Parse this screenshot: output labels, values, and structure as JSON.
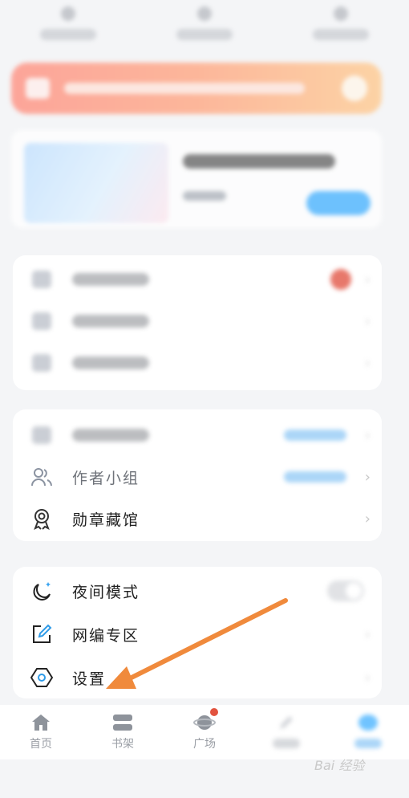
{
  "groups": [
    {
      "rows": [
        {
          "label": "作者小组",
          "name": "author-group",
          "icon": "author-group-icon"
        },
        {
          "label": "勋章藏馆",
          "name": "medal-hall",
          "icon": "medal-icon"
        }
      ]
    },
    {
      "rows": [
        {
          "label": "夜间模式",
          "name": "night-mode",
          "icon": "moon-icon"
        },
        {
          "label": "网编专区",
          "name": "editor-zone",
          "icon": "edit-icon"
        },
        {
          "label": "设置",
          "name": "settings",
          "icon": "settings-icon"
        }
      ]
    }
  ],
  "bottom_nav": {
    "home": "首页",
    "bookshelf": "书架",
    "plaza": "广场"
  },
  "watermark": "Bai 经验",
  "colors": {
    "accent": "#41b0ff",
    "arrow": "#f08a3c",
    "promo_start": "#ff8a7a",
    "promo_end": "#ffc88a"
  }
}
